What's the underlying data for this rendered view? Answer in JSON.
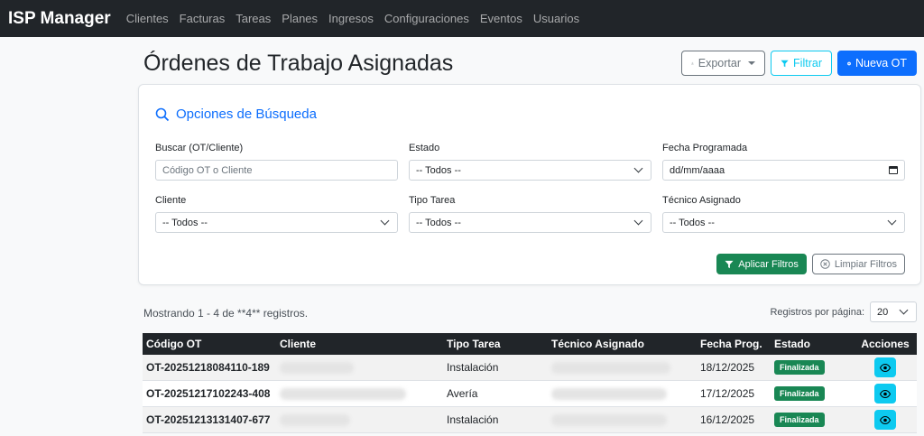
{
  "navbar": {
    "brand": "ISP Manager",
    "items": [
      "Clientes",
      "Facturas",
      "Tareas",
      "Planes",
      "Ingresos",
      "Configuraciones",
      "Eventos",
      "Usuarios"
    ]
  },
  "header": {
    "title": "Órdenes de Trabajo Asignadas",
    "export_label": "Exportar",
    "filter_label": "Filtrar",
    "new_label": "Nueva OT"
  },
  "search": {
    "title": "Opciones de Búsqueda",
    "fields": {
      "buscar": {
        "label": "Buscar (OT/Cliente)",
        "placeholder": "Código OT o Cliente"
      },
      "estado": {
        "label": "Estado",
        "value": "-- Todos --"
      },
      "fecha": {
        "label": "Fecha Programada",
        "value": "dd/mm/aaaa"
      },
      "cliente": {
        "label": "Cliente",
        "value": "-- Todos --"
      },
      "tipo": {
        "label": "Tipo Tarea",
        "value": "-- Todos --"
      },
      "tecnico": {
        "label": "Técnico Asignado",
        "value": "-- Todos --"
      }
    },
    "apply_label": "Aplicar Filtros",
    "clear_label": "Limpiar Filtros"
  },
  "results": {
    "info": "Mostrando 1 - 4 de **4** registros.",
    "per_page_label": "Registros por página:",
    "per_page_value": "20"
  },
  "table": {
    "headers": [
      "Código OT",
      "Cliente",
      "Tipo Tarea",
      "Técnico Asignado",
      "Fecha Prog.",
      "Estado",
      "Acciones"
    ],
    "rows": [
      {
        "codigo": "OT-20251218084110-189",
        "tipo": "Instalación",
        "fecha": "18/12/2025",
        "estado": "Finalizada"
      },
      {
        "codigo": "OT-20251217102243-408",
        "tipo": "Avería",
        "fecha": "17/12/2025",
        "estado": "Finalizada"
      },
      {
        "codigo": "OT-20251213131407-677",
        "tipo": "Instalación",
        "fecha": "16/12/2025",
        "estado": "Finalizada"
      }
    ]
  },
  "colors": {
    "navbar": "#212529",
    "primary": "#0d6efd",
    "info": "#0dcaf0",
    "success": "#198754",
    "secondary": "#6c757d"
  },
  "icons": {
    "export": "download-icon",
    "filter": "funnel-icon",
    "new": "plus-circle-icon",
    "search": "search-icon",
    "dropdown": "chevron-down-icon",
    "calendar": "calendar-icon",
    "clear": "x-circle-icon",
    "view": "eye-icon"
  }
}
